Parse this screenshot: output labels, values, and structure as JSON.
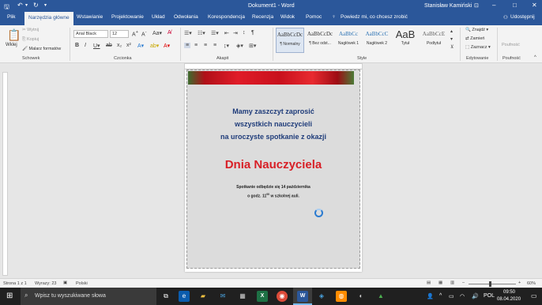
{
  "titlebar": {
    "title": "Dokument1 - Word",
    "user": "Stanisław Kamiński"
  },
  "tabs": [
    "Plik",
    "Narzędzia główne",
    "Wstawianie",
    "Projektowanie",
    "Układ",
    "Odwołania",
    "Korespondencja",
    "Recenzja",
    "Widok",
    "Pomoc"
  ],
  "tellme": "Powiedz mi, co chcesz zrobić",
  "share": "Udostępnij",
  "clipboard": {
    "paste": "Wklej",
    "cut": "Wytnij",
    "copy": "Kopiuj",
    "painter": "Malarz formatów",
    "label": "Schowek"
  },
  "font": {
    "name": "Arial Black",
    "size": "12",
    "label": "Czcionka"
  },
  "paragraph": {
    "label": "Akapit"
  },
  "styles": {
    "label": "Style",
    "items": [
      {
        "preview": "AaBbCcDc",
        "name": "¶ Normalny"
      },
      {
        "preview": "AaBbCcDc",
        "name": "¶ Bez odst..."
      },
      {
        "preview": "AaBbCc",
        "name": "Nagłówek 1"
      },
      {
        "preview": "AaBbCcC",
        "name": "Nagłówek 2"
      },
      {
        "preview": "AaB",
        "name": "Tytuł"
      },
      {
        "preview": "AaBbCcE",
        "name": "Podtytuł"
      }
    ]
  },
  "editing": {
    "find": "Znajdź",
    "replace": "Zamień",
    "select": "Zaznacz",
    "label": "Edytowanie"
  },
  "sensitivity": {
    "item": "Poufność",
    "label": "Poufność"
  },
  "document": {
    "line1": "Mamy zaszczyt zaprosić",
    "line2": "wszystkich nauczycieli",
    "line3": "na uroczyste spotkanie z okazji",
    "headline": "Dnia Nauczyciela",
    "small1": "Spotkanie odbędzie się 14 października",
    "small2_pre": "o godz. 11",
    "small2_sup": "00",
    "small2_post": " w szkolnej auli."
  },
  "status": {
    "page": "Strona 1 z 1",
    "words": "Wyrazy: 23",
    "lang": "Polski",
    "zoom": "60%"
  },
  "taskbar": {
    "search": "Wpisz tu wyszukiwane słowa",
    "lang": "POL",
    "time": "09:50",
    "date": "08.04.2020"
  },
  "colors": {
    "accent": "#2b579a",
    "headline": "#d81f26",
    "invite_text": "#1f3c7a"
  }
}
